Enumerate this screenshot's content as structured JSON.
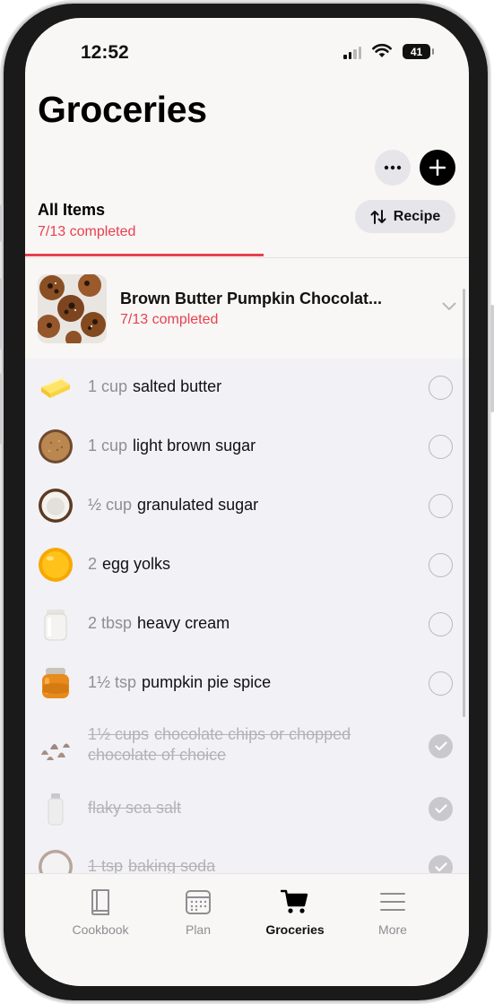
{
  "status_bar": {
    "time": "12:52",
    "battery": "41"
  },
  "header": {
    "title": "Groceries"
  },
  "tabs": {
    "all_items_label": "All Items",
    "all_items_count": "7/13 completed",
    "recipe_button_label": "Recipe"
  },
  "recipe": {
    "title": "Brown Butter Pumpkin Chocolat...",
    "count": "7/13 completed"
  },
  "items": [
    {
      "qty": "1 cup",
      "name": "salted butter",
      "checked": false,
      "icon": "butter-icon"
    },
    {
      "qty": "1 cup",
      "name": "light brown sugar",
      "checked": false,
      "icon": "brown-sugar-icon"
    },
    {
      "qty": "½ cup",
      "name": "granulated sugar",
      "checked": false,
      "icon": "granulated-sugar-icon"
    },
    {
      "qty": "2",
      "name": "egg yolks",
      "checked": false,
      "icon": "egg-yolk-icon"
    },
    {
      "qty": "2 tbsp",
      "name": "heavy cream",
      "checked": false,
      "icon": "heavy-cream-icon"
    },
    {
      "qty": "1½ tsp",
      "name": "pumpkin pie spice",
      "checked": false,
      "icon": "spice-jar-icon"
    },
    {
      "qty": "1½ cups",
      "name": "chocolate chips or chopped chocolate of choice",
      "checked": true,
      "icon": "chocolate-chips-icon"
    },
    {
      "qty": "",
      "name": "flaky sea salt",
      "checked": true,
      "icon": "salt-shaker-icon"
    },
    {
      "qty": "1 tsp",
      "name": "baking soda",
      "checked": true,
      "icon": "baking-soda-icon"
    }
  ],
  "tabbar": [
    {
      "label": "Cookbook",
      "icon": "book-icon",
      "active": false
    },
    {
      "label": "Plan",
      "icon": "calendar-icon",
      "active": false
    },
    {
      "label": "Groceries",
      "icon": "cart-icon",
      "active": true
    },
    {
      "label": "More",
      "icon": "menu-icon",
      "active": false
    }
  ],
  "colors": {
    "accent": "#e8404e",
    "background": "#f8f7f5",
    "list_background": "#f2f1f6"
  }
}
